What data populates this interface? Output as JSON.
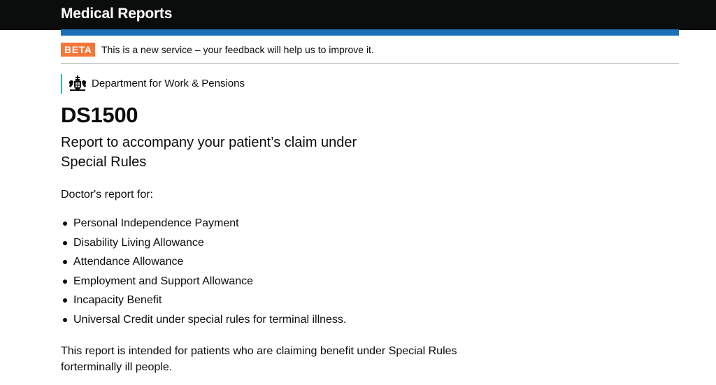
{
  "header": {
    "title": "Medical Reports"
  },
  "phase_banner": {
    "tag": "BETA",
    "text": "This is a new service – your feedback will help us to improve it."
  },
  "organisation": {
    "name": "Department for Work & Pensions",
    "logo_icon": "royal-coat-of-arms-icon"
  },
  "form": {
    "code": "DS1500",
    "subtitle": "Report to accompany your patient’s claim under Special Rules",
    "intro": "Doctor's report for:",
    "benefits": [
      "Personal Independence Payment",
      "Disability Living Allowance",
      "Attendance Allowance",
      "Employment and Support Allowance",
      "Incapacity Benefit",
      "Universal Credit under special rules for terminal illness."
    ],
    "note": "This report is intended for patients who are claiming benefit under Special Rules forterminally ill people."
  },
  "colors": {
    "header_background": "#0b0c0c",
    "brand_blue": "#1d70b8",
    "beta_tag": "#f47738",
    "organisation_accent": "#00beb7",
    "text": "#0b0c0c"
  }
}
